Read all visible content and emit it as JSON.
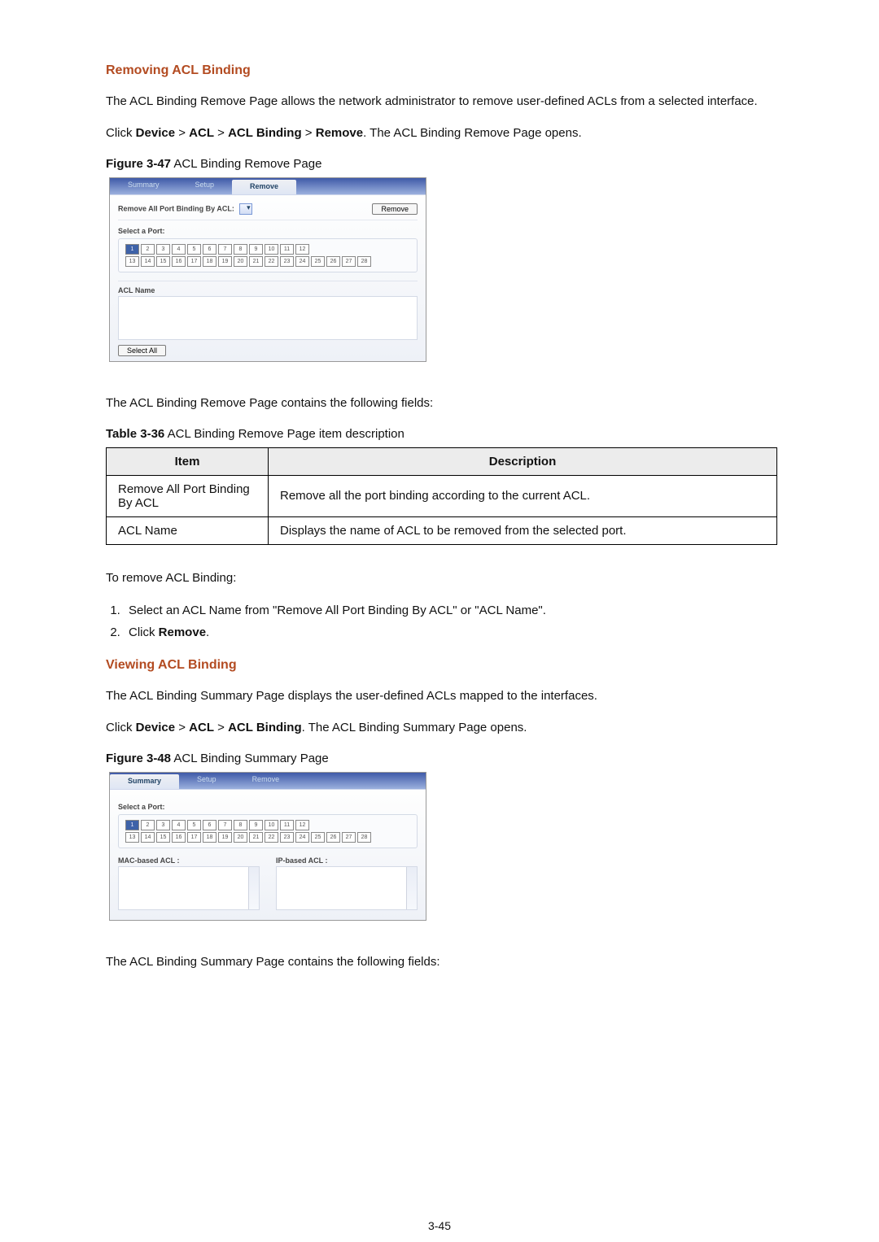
{
  "section1": {
    "title": "Removing ACL Binding",
    "intro": "The ACL Binding Remove Page allows the network administrator to remove user-defined ACLs from a selected interface.",
    "navPrefix": "Click ",
    "navBoldParts": [
      "Device",
      "ACL",
      "ACL Binding",
      "Remove"
    ],
    "navSuffix": ". The ACL Binding Remove Page opens.",
    "figLabel": "Figure 3-47",
    "figCaption": " ACL Binding Remove Page",
    "afterFields": "The ACL Binding Remove Page contains the following fields:",
    "tableLabel": "Table 3-36",
    "tableCaption": " ACL Binding Remove Page item description",
    "table": {
      "headers": [
        "Item",
        "Description"
      ],
      "rows": [
        {
          "item": "Remove All Port Binding By ACL",
          "desc": "Remove all the port binding according to the current ACL."
        },
        {
          "item": "ACL Name",
          "desc": "Displays the name of ACL to be removed from the selected port."
        }
      ]
    },
    "stepsIntro": "To remove ACL Binding:",
    "steps": [
      "Select an ACL Name from \"Remove All Port Binding By ACL\" or \"ACL Name\".",
      "Click "
    ],
    "step2Bold": "Remove",
    "step2Suffix": "."
  },
  "screenshot1": {
    "tabs": [
      "Summary",
      "Setup",
      "Remove"
    ],
    "activeTab": "Remove",
    "removeLabel": "Remove All Port Binding By ACL:",
    "removeBtn": "Remove",
    "selectPort": "Select a Port:",
    "aclName": "ACL Name",
    "selectAllBtn": "Select All",
    "ports": {
      "row1": [
        "1",
        "2",
        "3",
        "4",
        "5",
        "6",
        "7",
        "8",
        "9",
        "10",
        "11",
        "12"
      ],
      "row2": [
        "13",
        "14",
        "15",
        "16",
        "17",
        "18",
        "19",
        "20",
        "21",
        "22",
        "23",
        "24",
        "25",
        "26",
        "27",
        "28"
      ]
    }
  },
  "section2": {
    "title": "Viewing ACL Binding",
    "intro": "The ACL Binding Summary Page displays the user-defined ACLs mapped to the interfaces.",
    "navPrefix": "Click ",
    "navBoldParts": [
      "Device",
      "ACL",
      "ACL Binding"
    ],
    "navSuffix": ". The ACL Binding Summary Page opens.",
    "figLabel": "Figure 3-48",
    "figCaption": " ACL Binding Summary Page",
    "afterFields": "The ACL Binding Summary Page contains the following fields:"
  },
  "screenshot2": {
    "tabs": [
      "Summary",
      "Setup",
      "Remove"
    ],
    "activeTab": "Summary",
    "selectPort": "Select a Port:",
    "macLabel": "MAC-based ACL :",
    "ipLabel": "IP-based ACL :",
    "ports": {
      "row1": [
        "1",
        "2",
        "3",
        "4",
        "5",
        "6",
        "7",
        "8",
        "9",
        "10",
        "11",
        "12"
      ],
      "row2": [
        "13",
        "14",
        "15",
        "16",
        "17",
        "18",
        "19",
        "20",
        "21",
        "22",
        "23",
        "24",
        "25",
        "26",
        "27",
        "28"
      ]
    }
  },
  "pageNumber": "3-45"
}
